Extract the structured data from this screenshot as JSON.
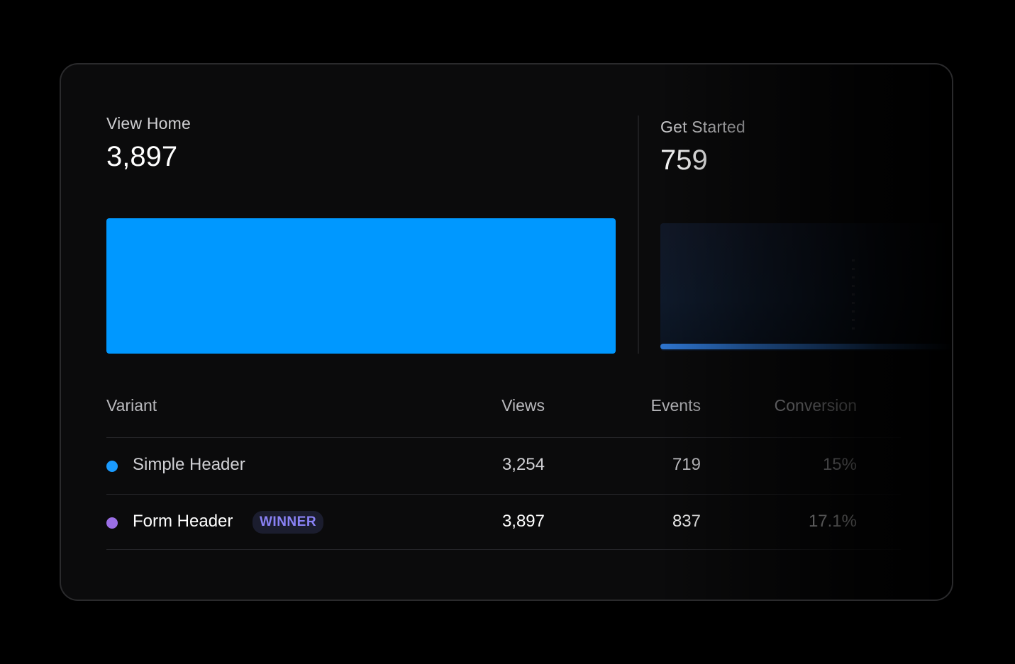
{
  "metrics": {
    "left": {
      "label": "View Home",
      "value": "3,897"
    },
    "right": {
      "label": "Get Started",
      "value": "759"
    }
  },
  "table": {
    "headers": {
      "variant": "Variant",
      "views": "Views",
      "events": "Events",
      "conversion": "Conversion"
    },
    "rows": [
      {
        "variant": "Simple Header",
        "dot_color": "#1a9bff",
        "views": "3,254",
        "events": "719",
        "conversion": "15%",
        "badge": ""
      },
      {
        "variant": "Form Header",
        "dot_color": "#9b6fe6",
        "views": "3,897",
        "events": "837",
        "conversion": "17.1%",
        "badge": "WINNER"
      }
    ]
  },
  "colors": {
    "accent_blue": "#0098ff",
    "winner_purple": "#8a82f5"
  }
}
